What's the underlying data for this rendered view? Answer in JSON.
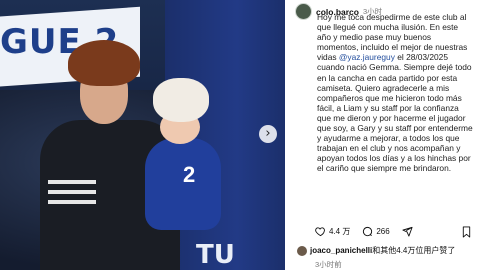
{
  "photo": {
    "banner_text": "GUE 2",
    "wall_text": "TU",
    "baby_number": "2",
    "next_arrow": "›"
  },
  "post": {
    "username": "colo.barco",
    "time": "3小时",
    "caption_before_mention": "Hoy me toca despedirme de este club al que llegué con mucha ilusión. En este año y medio pase muy buenos momentos, incluido el mejor de nuestras vidas ",
    "mention": "@yaz.jaureguy",
    "caption_after_mention": " el 28/03/2025 cuando nació Gemma. Siempre dejé todo en la cancha en cada partido por esta camiseta. Quiero agradecerle a mis compañeros que me hicieron todo más fácil, a Liam y su staff por la confianza que me dieron y por hacerme el jugador que soy, a Gary y su staff por entenderme y ayudarme a mejorar, a todos los que trabajan en el club y nos acompañan y apoyan todos los días y a los hinchas por el cariño que siempre me brindaron."
  },
  "actions": {
    "likes_count": "4.4 万",
    "comments_count": "266"
  },
  "liked_by": {
    "user": "joaco_panichelli",
    "text": "和其他4.4万位用户赞了"
  },
  "posted_time": "3小时前",
  "icons": [
    "heart-icon",
    "comment-icon",
    "share-icon",
    "bookmark-icon",
    "chevron-right-icon"
  ]
}
